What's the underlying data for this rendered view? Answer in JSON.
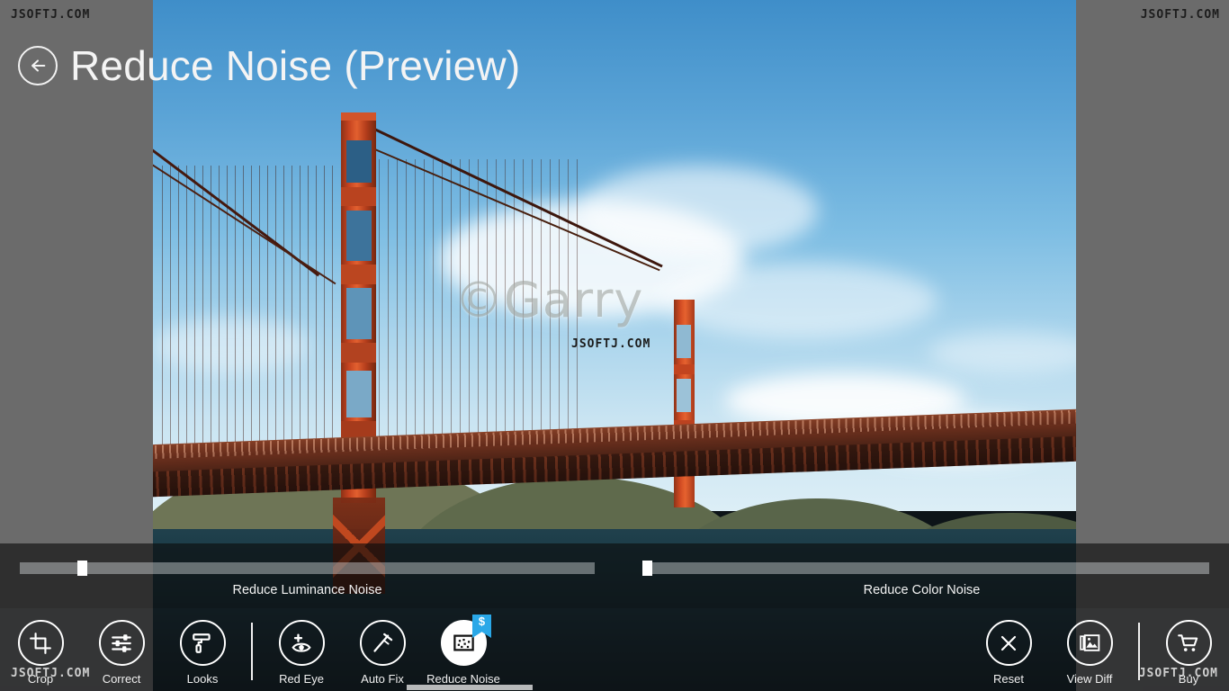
{
  "app": {
    "title": "Reduce Noise (Preview)",
    "back_icon": "back-arrow-icon"
  },
  "watermarks": {
    "top_left": "JSOFTJ.COM",
    "top_right": "JSOFTJ.COM",
    "bottom_left": "JSOFTJ.COM",
    "bottom_right": "JSOFTJ.COM",
    "image_main": "©Garry",
    "image_sub": "JSOFTJ.COM"
  },
  "sliders": [
    {
      "label": "Reduce Luminance Noise",
      "value": 5,
      "min": 0,
      "max": 100,
      "handle_pct": 5
    },
    {
      "label": "Reduce Color Noise",
      "value": 5,
      "min": 0,
      "max": 100,
      "handle_pct": 5
    }
  ],
  "appbar": {
    "left_commands": [
      {
        "label": "Crop",
        "icon": "crop-icon",
        "selected": false,
        "badge": null
      },
      {
        "label": "Correct",
        "icon": "sliders-icon",
        "selected": false,
        "badge": null
      },
      {
        "label": "Looks",
        "icon": "paint-roller-icon",
        "selected": false,
        "badge": null
      },
      {
        "label": "Red Eye",
        "icon": "red-eye-icon",
        "selected": false,
        "badge": null
      },
      {
        "label": "Auto Fix",
        "icon": "magic-wand-icon",
        "selected": false,
        "badge": null
      },
      {
        "label": "Reduce Noise",
        "icon": "reduce-noise-icon",
        "selected": true,
        "badge": "$"
      }
    ],
    "right_commands": [
      {
        "label": "Reset",
        "icon": "close-x-icon",
        "selected": false,
        "badge": null
      },
      {
        "label": "View Diff",
        "icon": "compare-icon",
        "selected": false,
        "badge": null
      },
      {
        "label": "Buy",
        "icon": "shopping-cart-icon",
        "selected": false,
        "badge": null
      }
    ]
  },
  "colors": {
    "background": "#6b6b6b",
    "accent_badge": "#2aa8e8",
    "text": "#f2f2f2",
    "appbar_overlay": "rgba(15,16,18,0.60)"
  }
}
